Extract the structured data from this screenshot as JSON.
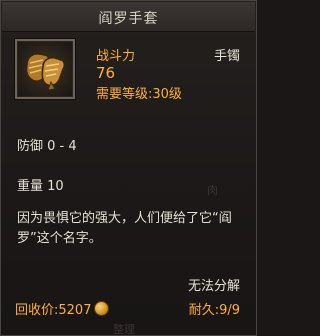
{
  "tooltip": {
    "title": "阎罗手套",
    "icon": "gloves-icon",
    "stat_label": "战斗力",
    "stat_value": "76",
    "level_requirement": "需要等级:30级",
    "slot_type": "手镯",
    "defense": "防御 0 - 4",
    "weight": "重量 10",
    "description": "因为畏惧它的强大，人们便给了它“阎罗”这个名字。",
    "no_disassemble": "无法分解",
    "recycle_price": "回收价:5207",
    "durability": "耐久:9/9",
    "coin_icon": "gold-coin-icon",
    "accent_color": "#ffb03a",
    "text_color": "#e6e1d6"
  },
  "background": {
    "ghost_char_1": "肉",
    "ghost_char_2": "整理"
  }
}
